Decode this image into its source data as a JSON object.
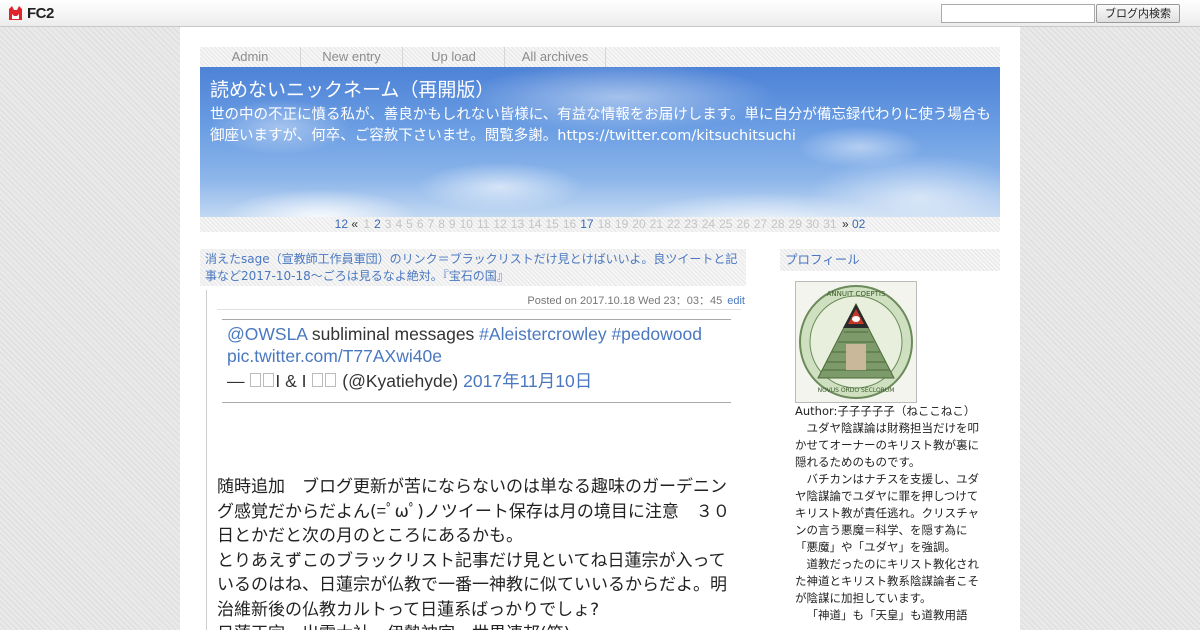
{
  "fc2bar": {
    "logo_text": "FC2",
    "search_placeholder": "",
    "search_button": "ブログ内検索"
  },
  "nav": {
    "items": [
      {
        "label": "Admin"
      },
      {
        "label": "New entry"
      },
      {
        "label": "Up load"
      },
      {
        "label": "All archives"
      }
    ]
  },
  "header": {
    "title": "読めないニックネーム（再開版）",
    "description": "世の中の不正に憤る私が、善良かもしれない皆様に、有益な情報をお届けします。単に自分が備忘録代わりに使う場合も御座いますが、何卒、ご容赦下さいませ。閲覧多謝。https://twitter.com/kitsuchitsuchi"
  },
  "calendar": {
    "prev_month": "12",
    "prev_arrow": "«",
    "days": [
      "1",
      "2",
      "3",
      "4",
      "5",
      "6",
      "7",
      "8",
      "9",
      "10",
      "11",
      "12",
      "13",
      "14",
      "15",
      "16",
      "17",
      "18",
      "19",
      "20",
      "21",
      "22",
      "23",
      "24",
      "25",
      "26",
      "27",
      "28",
      "29",
      "30",
      "31"
    ],
    "linked_days": [
      "2",
      "17"
    ],
    "next_arrow": "»",
    "next_month": "02"
  },
  "entry": {
    "title": "消えたsage（宣教師工作員軍団）のリンク＝ブラックリストだけ見とけばいいよ。良ツイートと記事など2017-10-18～ごろは見るなよ絶対。『宝石の国』",
    "posted": "Posted on 2017.10.18 Wed 23：03：45",
    "edit": "edit",
    "tweet": {
      "mention": "@OWSLA",
      "text": " subliminal messages ",
      "hashtag1": "#Aleistercrowley",
      "hashtag2": "#pedowood",
      "pic_link": "pic.twitter.com/T77AXwi40e",
      "dash": "— ",
      "name_mid": "I & I",
      "handle": "(@Kyatiehyde)",
      "date": "2017年11月10日"
    },
    "body_lines": [
      "随時追加　ブログ更新が苦にならないのは単なる趣味のガーデニング感覚だからだよん(=ﾟωﾟ)ノツイート保存は月の境目に注意　３０日とかだと次の月のところにあるかも。",
      "とりあえずこのブラックリスト記事だけ見といてね日蓮宗が入っているのはね、日蓮宗が仏教で一番一神教に似ていいるからだよ。明治維新後の仏教カルトって日蓮系ばっかりでしょ?",
      "日蓮正宗、出雲大社、伊勢神宮、世界連邦(笑)"
    ]
  },
  "sidebar": {
    "profile_title": "プロフィール",
    "author": "Author:子子子子子（ねここねこ）",
    "profile_paragraphs": [
      "ユダヤ陰謀論は財務担当だけを叩かせてオーナーのキリスト教が裏に隠れるためのものです。",
      "バチカンはナチスを支援し、ユダヤ陰謀論でユダヤに罪を押しつけてキリスト教が責任逃れ。クリスチャンの言う悪魔＝科学、を隠す為に「悪魔」や「ユダヤ」を強調。",
      "道教だったのにキリスト教化された神道とキリスト教系陰謀論者こそが陰謀に加担しています。",
      "「神道」も「天皇」も道教用語"
    ],
    "seal_top_text": "ANNUIT COEPTIS",
    "seal_bottom_text": "NOVUS ORDO SECLORUM"
  },
  "colors": {
    "link": "#4a78c0",
    "header_sky": "#5a8edb"
  }
}
